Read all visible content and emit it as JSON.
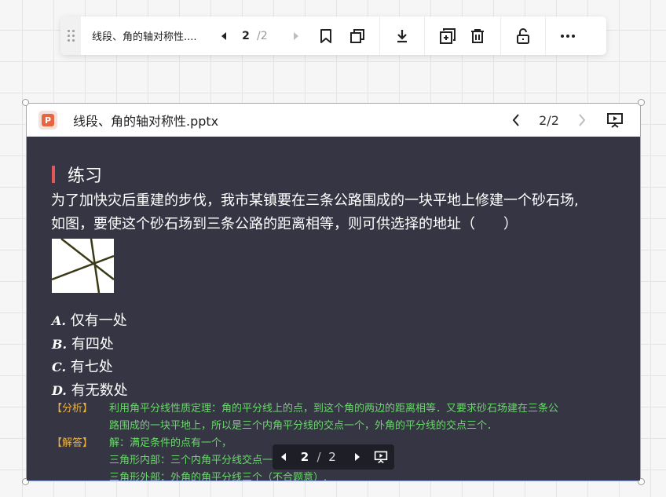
{
  "toolbar": {
    "file_title": "线段、角的轴对称性....",
    "current_page": "2",
    "total_pages": "/2"
  },
  "card": {
    "file_name": "线段、角的轴对称性.pptx",
    "page_indicator": "2/2",
    "icon_letter": "P"
  },
  "slide": {
    "heading": "练习",
    "question_line1": "为了加快灾后重建的步伐，我市某镇要在三条公路围成的一块平地上修建一个砂石场,",
    "question_line2": "如图，要使这个砂石场到三条公路的距离相等，则可供选择的地址（　　）",
    "options": [
      {
        "letter": "A.",
        "text": " 仅有一处"
      },
      {
        "letter": "B.",
        "text": " 有四处"
      },
      {
        "letter": "C.",
        "text": " 有七处"
      },
      {
        "letter": "D.",
        "text": " 有无数处"
      }
    ],
    "analysis_tag": "【分析】",
    "analysis_line1": "利用角平分线性质定理：角的平分线上的点，到这个角的两边的距离相等．又要求砂石场建在三条公",
    "analysis_line2": "路围成的一块平地上，所以是三个内角平分线的交点一个，外角的平分线的交点三个．",
    "solution_tag": "【解答】",
    "solution_line1": "解：满足条件的点有一个，",
    "solution_line2": "三角形内部：三个内角平分线交点一个，",
    "solution_line3": "三角形外部：外角的角平分线三个（不合题意）."
  },
  "mini_pager": {
    "current": "2",
    "separator": "/",
    "total": "2"
  },
  "colors": {
    "slide_bg": "#363543",
    "heading_bar": "#e25757",
    "analysis_text": "#6cd66e",
    "tag_text": "#e8b245",
    "selection_border": "#8da7f2",
    "ppt_brand": "#e8663f"
  }
}
